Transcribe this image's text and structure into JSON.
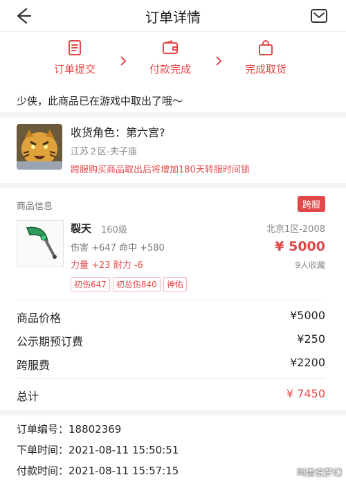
{
  "header": {
    "title": "订单详情"
  },
  "steps": [
    {
      "label": "订单提交",
      "icon": "order-submit-icon"
    },
    {
      "label": "付款完成",
      "icon": "wallet-icon"
    },
    {
      "label": "完成取货",
      "icon": "bag-icon"
    }
  ],
  "notice": "少侠，此商品已在游戏中取出了哦～",
  "role": {
    "name": "收货角色：第六宫?",
    "server": "江苏２区-夫子庙",
    "warning": "跨服购买商品取出后将增加180天转服时间锁"
  },
  "product": {
    "section_title": "商品信息",
    "badge": "跨服",
    "name": "裂天",
    "level": "160级",
    "stats": "伤害 +647 命中 +580",
    "stats2": "力量 +23 耐力 -6",
    "server": "北京1区-2008",
    "price": "¥ 5000",
    "favorites": "9人收藏",
    "tags": [
      "初伤647",
      "初总伤840",
      "神佑"
    ]
  },
  "fees": {
    "price_label": "商品价格",
    "price_value": "¥5000",
    "preorder_label": "公示期预订费",
    "preorder_value": "¥250",
    "cross_label": "跨服费",
    "cross_value": "¥2200",
    "total_label": "总计",
    "total_value": "¥ 7450"
  },
  "order": {
    "number": "订单编号：18802369",
    "created": "下单时间：2021-08-11 15:50:51",
    "paid": "付款时间：2021-08-11 15:57:15"
  },
  "watermark": "叫兽说梦幻",
  "colors": {
    "accent": "#e34848",
    "muted": "#888888",
    "separator": "#f4f4f4"
  }
}
